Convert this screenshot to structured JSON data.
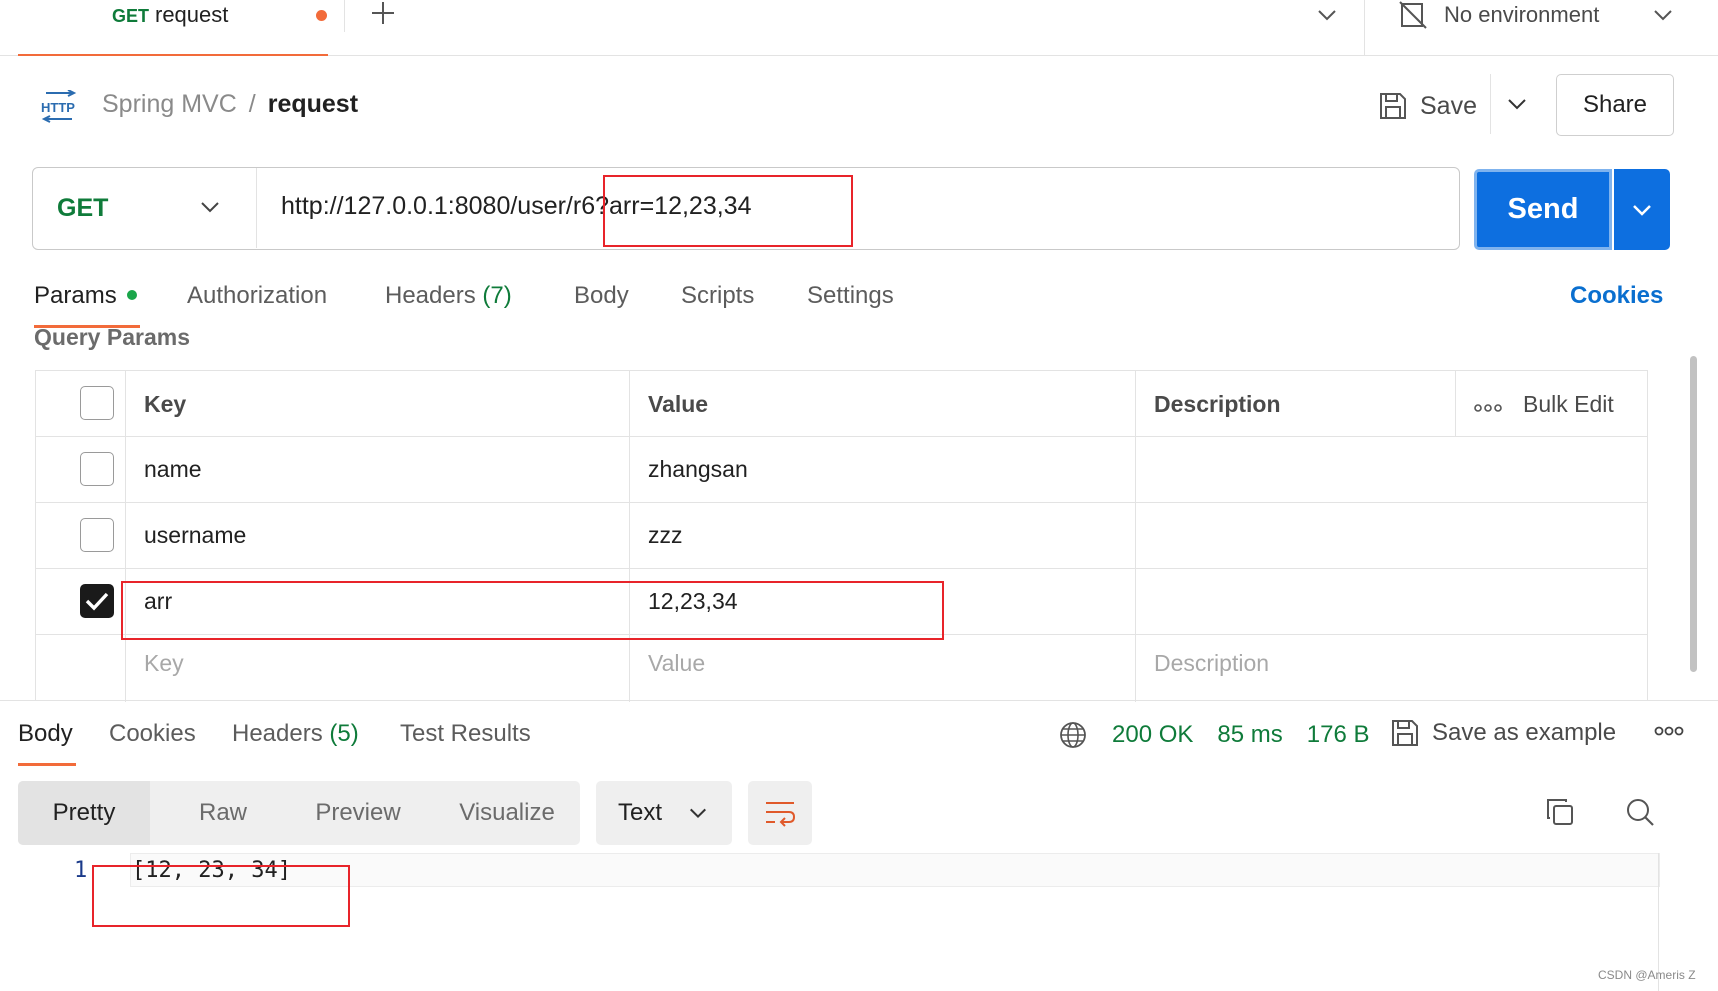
{
  "tab": {
    "method": "GET",
    "name": "request"
  },
  "environment": {
    "label": "No environment"
  },
  "breadcrumb": {
    "icon_text": "HTTP",
    "collection": "Spring MVC",
    "separator": "/",
    "current": "request"
  },
  "toolbar": {
    "save_label": "Save",
    "share_label": "Share"
  },
  "request": {
    "method": "GET",
    "url": "http://127.0.0.1:8080/user/r6?arr=12,23,34",
    "send_label": "Send"
  },
  "request_tabs": [
    {
      "label": "Params"
    },
    {
      "label": "Authorization"
    },
    {
      "label": "Headers",
      "count": "(7)"
    },
    {
      "label": "Body"
    },
    {
      "label": "Scripts"
    },
    {
      "label": "Settings"
    }
  ],
  "cookies_link": "Cookies",
  "query_params": {
    "title": "Query Params",
    "headers": {
      "key": "Key",
      "value": "Value",
      "description": "Description",
      "bulk_edit": "Bulk Edit"
    },
    "rows": [
      {
        "key": "name",
        "value": "zhangsan",
        "checked": false
      },
      {
        "key": "username",
        "value": "zzz",
        "checked": false
      },
      {
        "key": "arr",
        "value": "12,23,34",
        "checked": true
      }
    ],
    "placeholders": {
      "key": "Key",
      "value": "Value",
      "description": "Description"
    }
  },
  "response": {
    "tabs": [
      {
        "label": "Body"
      },
      {
        "label": "Cookies"
      },
      {
        "label": "Headers",
        "count": "(5)"
      },
      {
        "label": "Test Results"
      }
    ],
    "status": "200 OK",
    "time": "85 ms",
    "size": "176 B",
    "save_example_label": "Save as example",
    "view_modes": [
      "Pretty",
      "Raw",
      "Preview",
      "Visualize"
    ],
    "format": "Text",
    "line_number": "1",
    "body": "[12, 23, 34]"
  },
  "watermark": "CSDN @Ameris Z",
  "colors": {
    "accent": "#f26b3a",
    "send": "#0d6fe0",
    "get": "#0f7b3a",
    "annotation": "#e8242a"
  }
}
